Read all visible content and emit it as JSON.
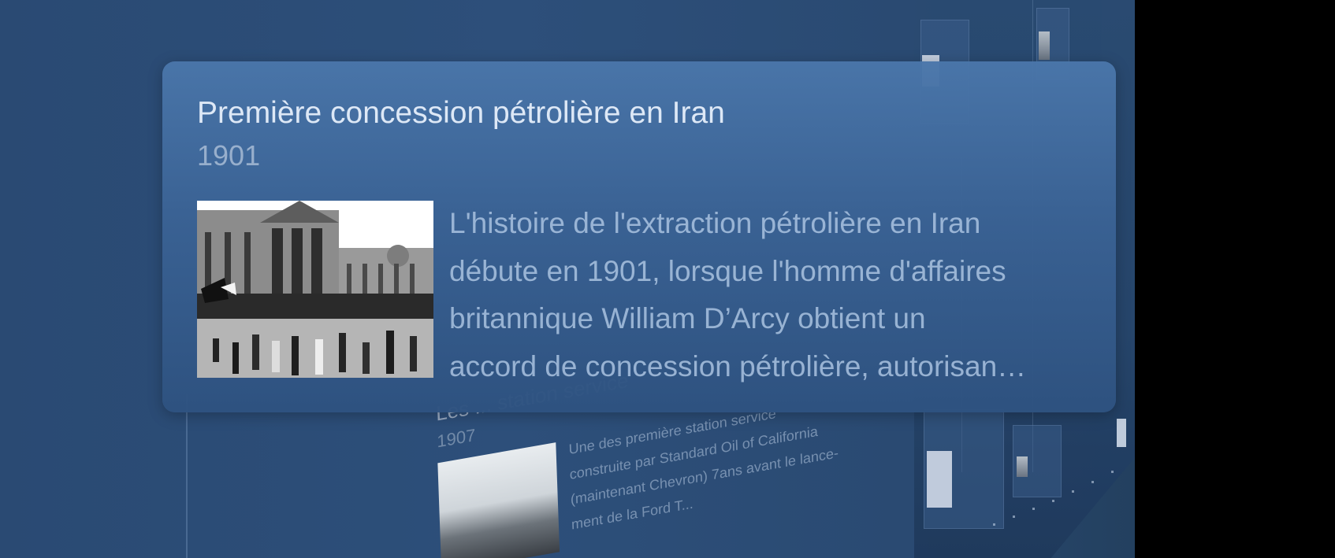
{
  "main_card": {
    "title": "Première concession pétrolière en Iran",
    "year": "1901",
    "description_lines": [
      "L'histoire de l'extraction pétrolière en Iran",
      "débute en 1901, lorsque l'homme d'affaires",
      "britannique William D’Arcy obtient un",
      "accord de concession pétrolière, autorisan…"
    ]
  },
  "background_card": {
    "title": "Les ... station service",
    "year": "1907",
    "description_lines": [
      "Une des première station service",
      "construite par Standard Oil of California",
      "(maintenant Chevron) 7ans avant le lance-",
      "ment de la Ford T..."
    ]
  },
  "colors": {
    "background": "#2d4f7a",
    "card": "#4a76aa",
    "title_text": "#dde8f6",
    "body_text": "#aac3e1"
  },
  "icons": {
    "photo": "historical-photo-icon"
  }
}
